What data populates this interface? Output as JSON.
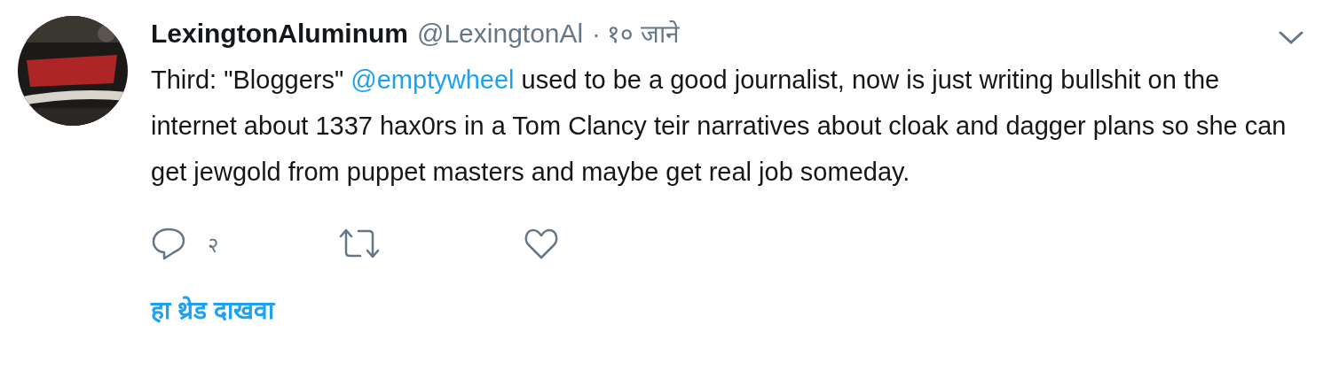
{
  "tweet": {
    "display_name": "LexingtonAluminum",
    "handle": "@LexingtonAl",
    "time": "· १० जाने",
    "text_before": "Third: \"Bloggers\"",
    "mention": "@emptywheel",
    "text_after": "used to be a good journalist, now is just writing bullshit on the internet about 1337 hax0rs in a Tom Clancy teir narratives about cloak and dagger plans so she can get jewgold from puppet masters and maybe get real job someday.",
    "reply_count": "२",
    "show_thread": "हा थ्रेड दाखवा"
  }
}
